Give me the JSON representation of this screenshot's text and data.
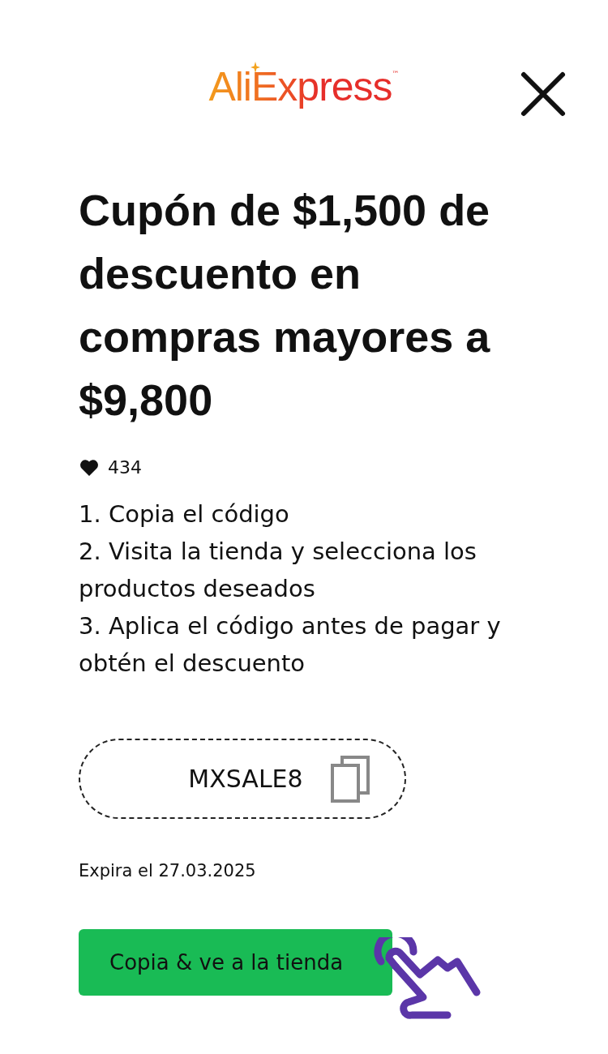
{
  "logo": {
    "text": "AliExpress",
    "mark": "™"
  },
  "title": "Cupón de $1,500 de descuento en compras mayores a $9,800",
  "likes": "434",
  "steps": [
    "1. Copia el código",
    "2. Visita la tienda y selecciona los productos deseados",
    "3. Aplica el código antes de pagar y obtén el descuento"
  ],
  "code": "MXSALE8",
  "expiry": "Expira el 27.03.2025",
  "button": "Copia & ve a la tienda"
}
